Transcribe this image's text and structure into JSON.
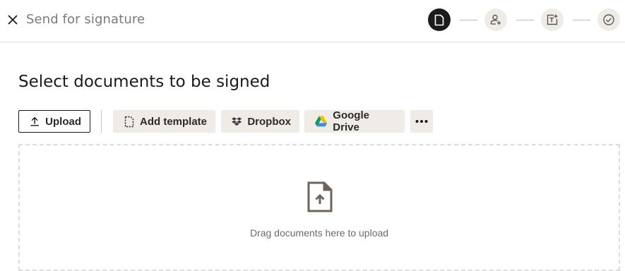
{
  "header": {
    "title": "Send for signature",
    "close_icon": "close-icon",
    "steps": [
      {
        "icon": "document-icon",
        "state": "active"
      },
      {
        "icon": "add-recipient-icon",
        "state": "inactive"
      },
      {
        "icon": "add-fields-icon",
        "state": "inactive"
      },
      {
        "icon": "review-check-icon",
        "state": "inactive"
      }
    ]
  },
  "main": {
    "title": "Select documents to be signed",
    "buttons": {
      "upload": "Upload",
      "add_template": "Add template",
      "dropbox": "Dropbox",
      "google_drive": "Google Drive",
      "more_icon": "more-options-icon"
    },
    "dropzone": {
      "text": "Drag documents here to upload",
      "icon": "document-upload-icon"
    }
  },
  "colors": {
    "accent_dark": "#1b1b1b",
    "step_inactive_bg": "#efece8",
    "button_bg": "#efece8",
    "dropbox_blue": "#0061fe",
    "muted_text": "#7a7a7a"
  }
}
